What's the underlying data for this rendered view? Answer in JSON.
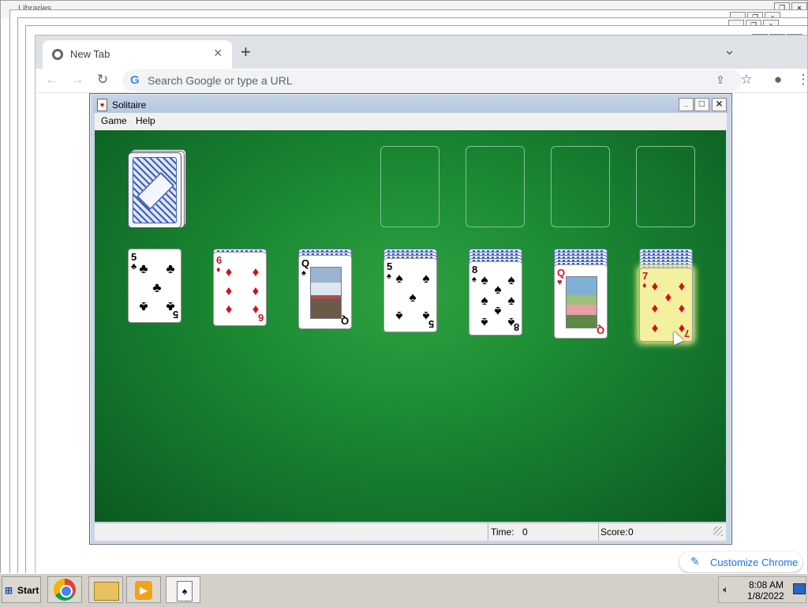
{
  "background_windows": {
    "top_label": "Libraries"
  },
  "chrome": {
    "tab_title": "New Tab",
    "tab_close": "×",
    "new_tab": "+",
    "tab_menu": "⌄",
    "omnibox_placeholder": "Search Google or type a URL",
    "customize_label": "Customize Chrome",
    "window_controls": {
      "minimize": "–",
      "restore": "❐",
      "close": "×"
    }
  },
  "solitaire": {
    "title": "Solitaire",
    "menu": [
      "Game",
      "Help"
    ],
    "controls": {
      "minimize": "_",
      "maximize": "□",
      "close": "×"
    },
    "status": {
      "time_label": "Time:",
      "time_value": "0",
      "score_label": "Score:",
      "score_value": "0"
    },
    "colors": {
      "felt": "#1c8a33",
      "red_suit": "#d0121b",
      "card_back": "#3d5fb8",
      "highlight": "#f3f1a0"
    },
    "stock": {
      "icon": "card-back"
    },
    "foundations": [
      {
        "empty": true
      },
      {
        "empty": true
      },
      {
        "empty": true
      },
      {
        "empty": true
      }
    ],
    "tableau": [
      {
        "hidden": 0,
        "rank": "5",
        "suit": "♣",
        "color": "black",
        "face": false
      },
      {
        "hidden": 1,
        "rank": "6",
        "suit": "♦",
        "color": "red",
        "face": false
      },
      {
        "hidden": 2,
        "rank": "Q",
        "suit": "♠",
        "color": "black",
        "face": true,
        "art": "winter-branch"
      },
      {
        "hidden": 3,
        "rank": "5",
        "suit": "♠",
        "color": "black",
        "face": false
      },
      {
        "hidden": 4,
        "rank": "8",
        "suit": "♠",
        "color": "black",
        "face": false
      },
      {
        "hidden": 5,
        "rank": "Q",
        "suit": "♥",
        "color": "red",
        "face": true,
        "art": "roses"
      },
      {
        "hidden": 6,
        "rank": "7",
        "suit": "♦",
        "color": "red",
        "face": false,
        "highlighted": true
      }
    ]
  },
  "taskbar": {
    "start_label": "Start",
    "apps": [
      "chrome-icon",
      "explorer-icon",
      "media-player-icon",
      "solitaire-icon"
    ],
    "clock_time": "8:08 AM",
    "clock_date": "1/8/2022"
  }
}
